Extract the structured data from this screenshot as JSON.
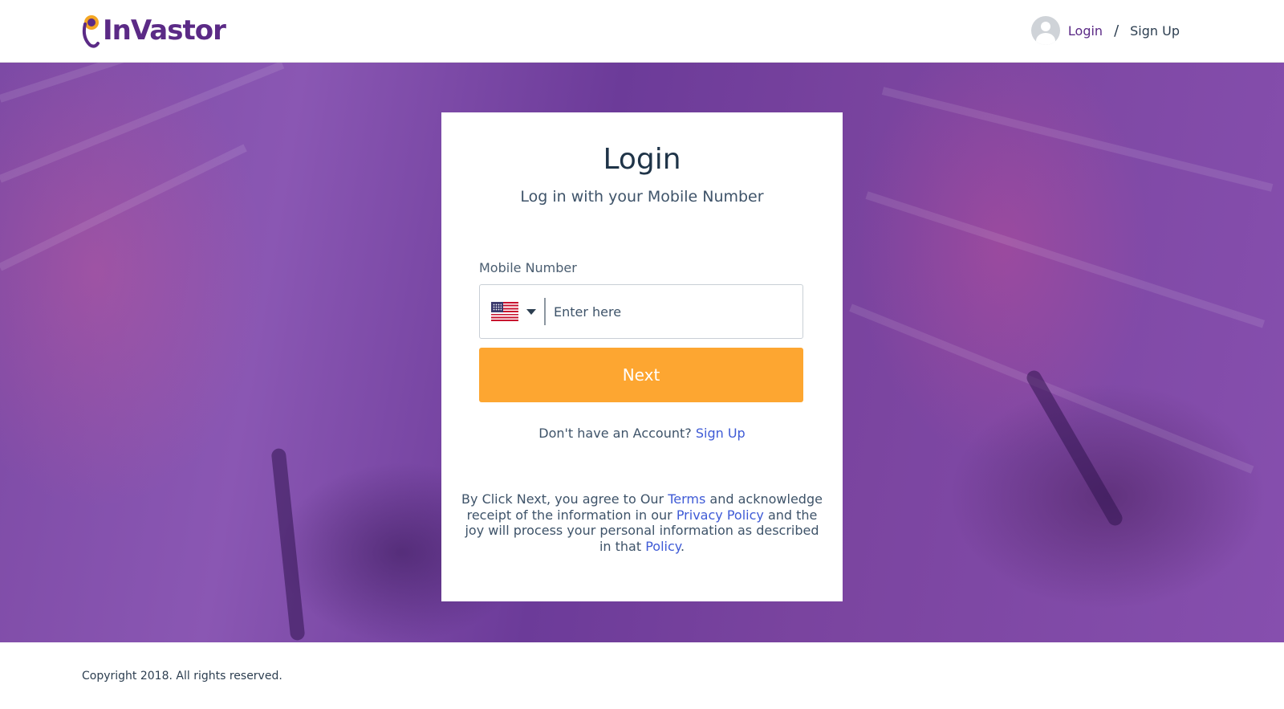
{
  "header": {
    "logo_text": "InVastor",
    "login_label": "Login",
    "separator": "/",
    "signup_label": "Sign Up"
  },
  "login_card": {
    "title": "Login",
    "subtitle": "Log in with your Mobile Number",
    "mobile_label": "Mobile Number",
    "country_flag": "US",
    "phone_placeholder": "Enter here",
    "phone_value": "",
    "next_label": "Next",
    "no_account_text": "Don't have an Account?",
    "signup_link": "Sign Up",
    "legal": {
      "part1": "By Click Next, you agree to Our ",
      "terms_link": "Terms",
      "part2": " and acknowledge receipt of the information in our ",
      "privacy_link": "Privacy Policy",
      "part3": " and the joy will process your personal information as described in that ",
      "policy_link": "Policy",
      "part4": "."
    }
  },
  "footer": {
    "copyright": "Copyright 2018. All rights reserved."
  },
  "colors": {
    "brand_purple": "#5b2a86",
    "accent_orange": "#fda631",
    "link_blue": "#3f5bd6",
    "hero_overlay": "#7d4aa5"
  }
}
